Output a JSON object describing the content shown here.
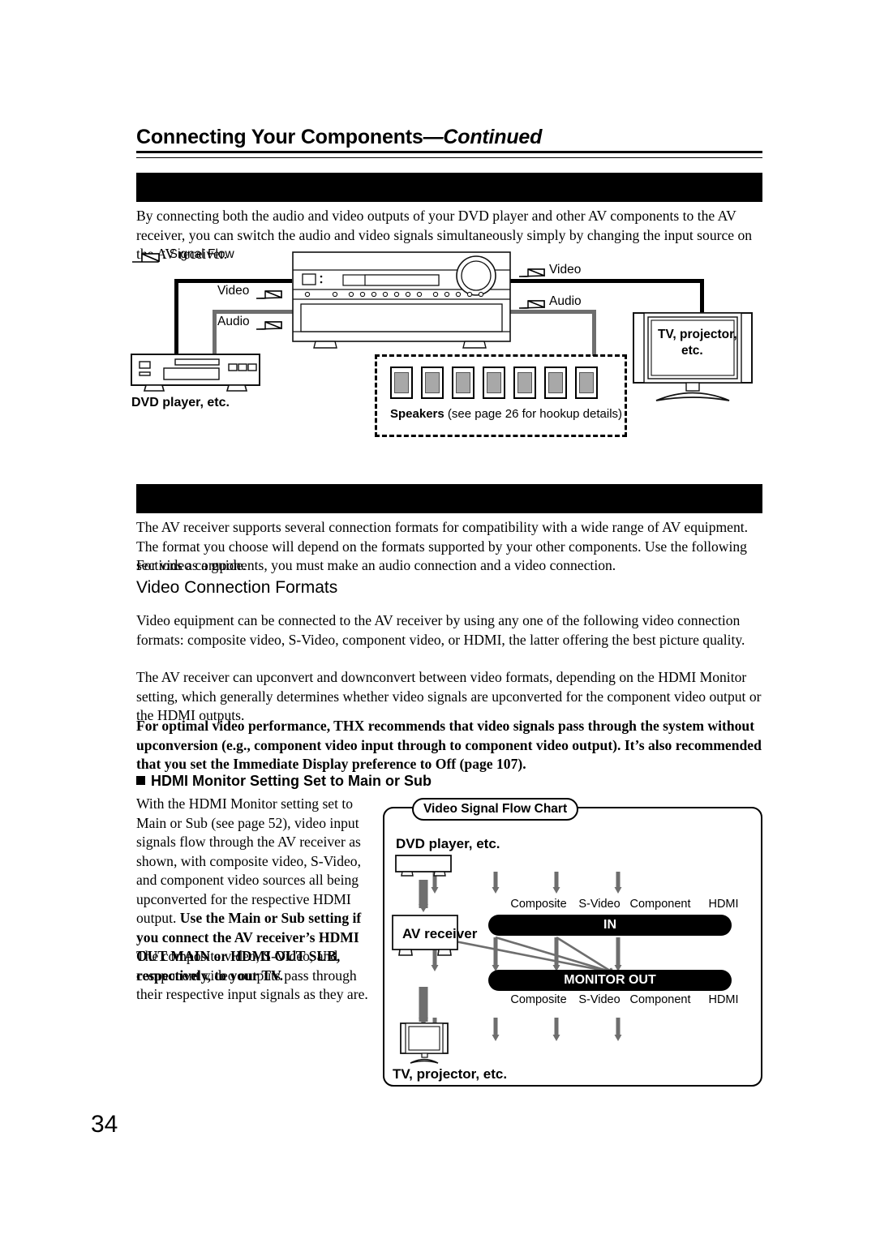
{
  "header": {
    "title_main": "Connecting Your Components",
    "title_dash": "—",
    "title_cont": "Continued"
  },
  "section1": {
    "banner_text": "",
    "paragraph": "By connecting both the audio and video outputs of your DVD player and other AV components to the AV receiver, you can switch the audio and video signals simultaneously simply by changing the input source on the AV receiver."
  },
  "hookup_diagram": {
    "legend": ": Signal Flow",
    "video_label_left": "Video",
    "audio_label_left": "Audio",
    "video_label_right": "Video",
    "audio_label_right": "Audio",
    "dvd_label": "DVD player, etc.",
    "tv_label_line1": "TV, projector,",
    "tv_label_line2": "etc.",
    "speakers_bold": "Speakers",
    "speakers_rest": " (see page 26 for hookup details)",
    "speaker_count": 7
  },
  "section2": {
    "banner_text": "",
    "paragraph1": "The AV receiver supports several connection formats for compatibility with a wide range of AV equipment. The format you choose will depend on the formats supported by your other components. Use the following sections as a guide.",
    "paragraph2": "For video components, you must make an audio connection and a video connection.",
    "subhead": "Video Connection Formats",
    "paragraph3": "Video equipment can be connected to the AV receiver by using any one of the following video connection formats: composite video, S-Video, component video, or HDMI, the latter offering the best picture quality.",
    "paragraph4": "The AV receiver can upconvert and downconvert between video formats, depending on the HDMI Monitor setting, which generally determines whether video signals are upconverted for the component video output or the HDMI outputs.",
    "paragraph5_bold": "For optimal video performance, THX recommends that video signals pass through the system without upconversion (e.g., component video input through to component video output). It’s also recommended that you set the Immediate Display preference to Off (page 107)."
  },
  "section3": {
    "heading": "HDMI Monitor Setting Set to Main or Sub",
    "paragraph1_plain": "With the HDMI Monitor setting set to Main or Sub (see page 52), video input signals flow through the AV receiver as shown, with composite video, S-Video, and component video sources all being upconverted for the respective HDMI output. ",
    "paragraph1_bold": "Use the Main or Sub setting if you connect the AV receiver’s HDMI OUT MAIN or HDMI OUT SUB, respectively, to your TV.",
    "paragraph2": "The composite video, S-Video, and component video outputs pass through their respective input signals as they are."
  },
  "chart_data": {
    "type": "diagram",
    "title": "Video Signal Flow Chart",
    "source_label": "DVD player, etc.",
    "device_label": "AV receiver",
    "sink_label": "TV, projector, etc.",
    "in_bar": "IN",
    "out_bar": "MONITOR OUT",
    "in_ports": [
      "Composite",
      "S-Video",
      "Component",
      "HDMI"
    ],
    "out_ports": [
      "Composite",
      "S-Video",
      "Component",
      "HDMI"
    ],
    "routes": [
      {
        "from": "Composite",
        "to": "Composite",
        "kind": "pass-through"
      },
      {
        "from": "S-Video",
        "to": "S-Video",
        "kind": "pass-through"
      },
      {
        "from": "Component",
        "to": "Component",
        "kind": "pass-through"
      },
      {
        "from": "HDMI",
        "to": "HDMI",
        "kind": "pass-through"
      },
      {
        "from": "Composite",
        "to": "HDMI",
        "kind": "upconvert"
      },
      {
        "from": "S-Video",
        "to": "HDMI",
        "kind": "upconvert"
      },
      {
        "from": "Component",
        "to": "HDMI",
        "kind": "upconvert"
      }
    ],
    "arrow_color": "#6e6e6e",
    "bar_color": "#000000"
  },
  "footer": {
    "page_number": "34"
  }
}
